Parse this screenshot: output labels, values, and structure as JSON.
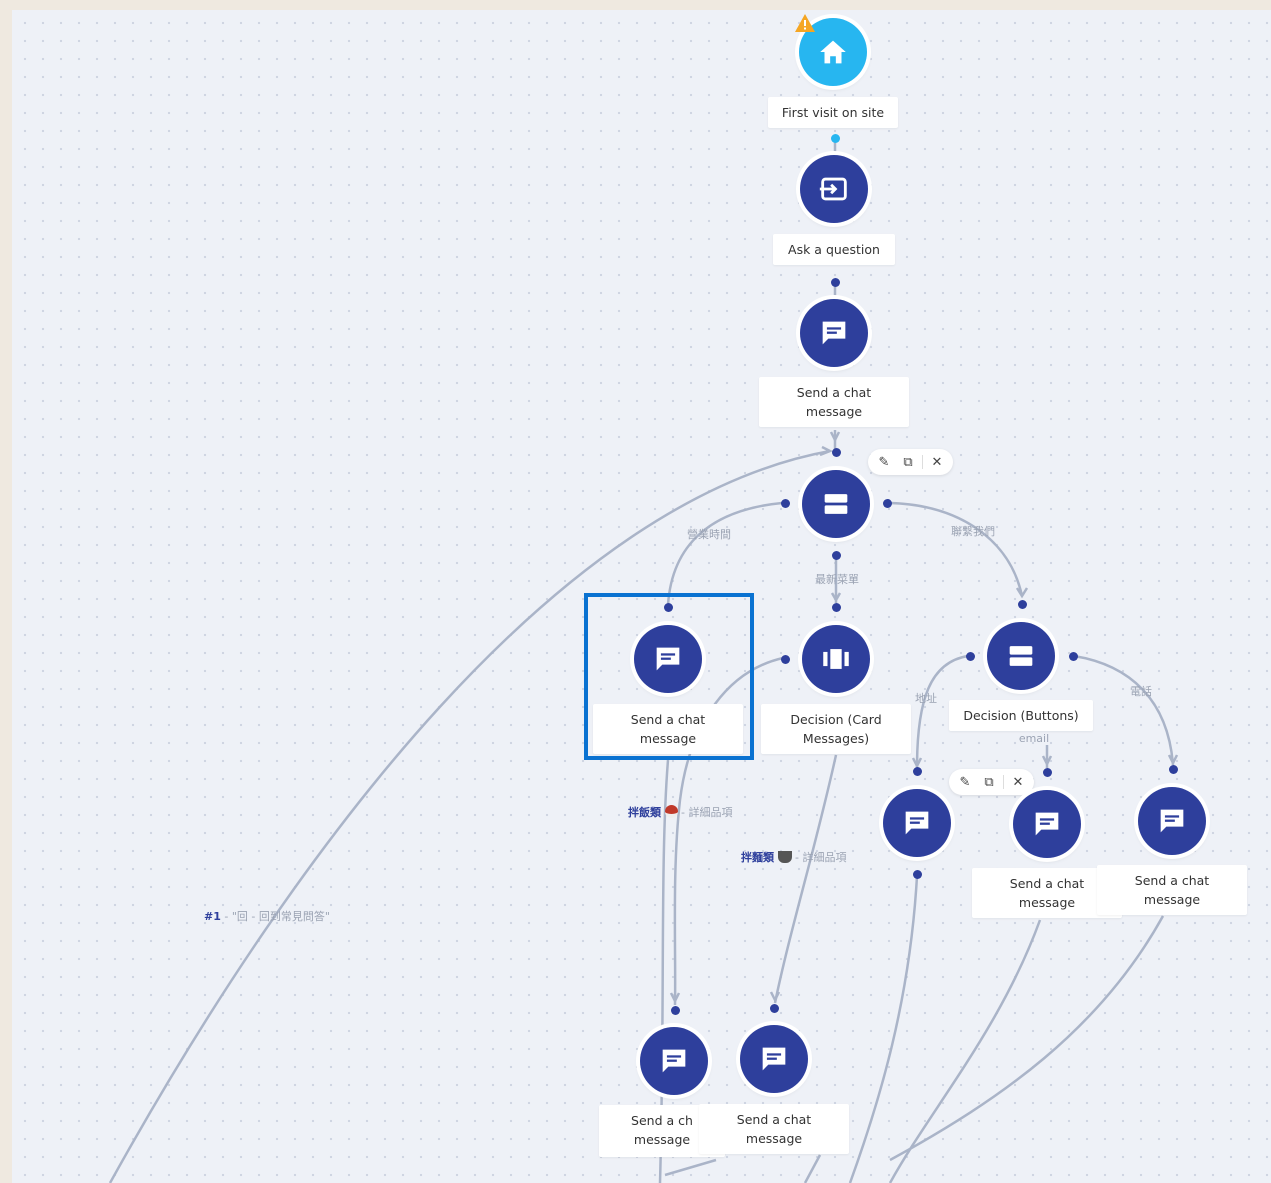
{
  "nodes": {
    "start_label": "First visit on site",
    "ask_label": "Ask a question",
    "send1_label": "Send a chat message",
    "decision_card_label": "Decision (Card Messages)",
    "decision_buttons_label": "Decision (Buttons)",
    "send_selected_label": "Send a chat message",
    "send_email_label": "Send a chat message",
    "send_phone_label": "Send a chat message",
    "send_bottom_a_label": "Send a ch message",
    "send_bottom_b_label": "Send a chat message"
  },
  "edges": {
    "business_hours": "營業時間",
    "latest_menu": "最新菜單",
    "contact_us": "聯繫我們",
    "address": "地址",
    "email": "email",
    "phone": "電話"
  },
  "link_labels": {
    "noodle1_name": "拌飯類",
    "noodle1_suffix": "- 詳細品項",
    "noodle2_name": "拌麵類",
    "noodle2_suffix": "- 詳細品項",
    "loop_name": "#1",
    "loop_suffix": "- \"回 - 回到常見問答\""
  },
  "colors": {
    "node": "#2e3f9c",
    "start": "#27b6f0",
    "selection": "#0a72d1",
    "warning": "#f5a623"
  },
  "icons": [
    "home-icon",
    "input-icon",
    "chat-icon",
    "decision-buttons-icon",
    "carousel-icon",
    "warning-icon",
    "edit-icon",
    "duplicate-icon",
    "close-icon"
  ]
}
